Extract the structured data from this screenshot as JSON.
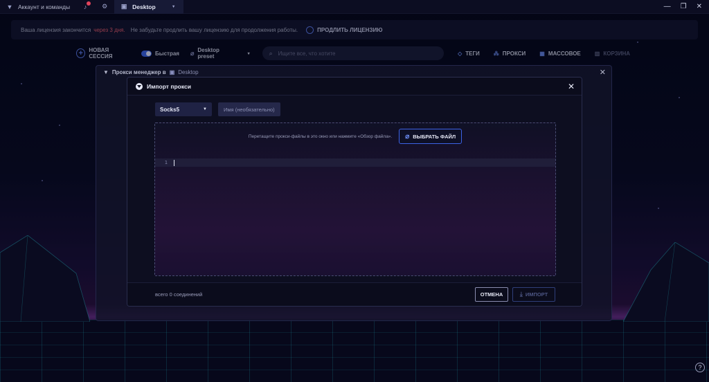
{
  "titlebar": {
    "tab_account": "Аккаунт и команды",
    "tab_desktop": "Desktop",
    "notification_count": "1",
    "controls": [
      "—",
      "❐",
      "✕"
    ]
  },
  "banner": {
    "text_before": "Ваша лицензия закончится",
    "warning": "через 3 дня.",
    "text_after": "Не забудьте продлить вашу лицензию для продолжения работы.",
    "renew_label": "ПРОДЛИТЬ ЛИЦЕНЗИЮ"
  },
  "toolbar": {
    "new_session": "НОВАЯ СЕССИЯ",
    "fast_label": "Быстрая",
    "preset": "Desktop preset",
    "search_placeholder": "Ищите все, что хотите",
    "tags": "ТЕГИ",
    "proxies": "ПРОКСИ",
    "bulk": "МАССОВОЕ",
    "trash": "КОРЗИНА"
  },
  "proxy_manager": {
    "title": "Прокси менеджер в",
    "workspace": "Desktop"
  },
  "modal": {
    "title": "Импорт прокси",
    "protocol": "Socks5",
    "name_placeholder": "Имя (необязательно)",
    "drop_hint": "Перетащите прокси-файлы в это окно или нажмите «Обзор файла».",
    "choose_file": "ВЫБРАТЬ ФАЙЛ",
    "line_number": "1",
    "total": "всего 0 соединений",
    "cancel": "ОТМЕНА",
    "import": "ИМПОРТ"
  },
  "help": "?"
}
